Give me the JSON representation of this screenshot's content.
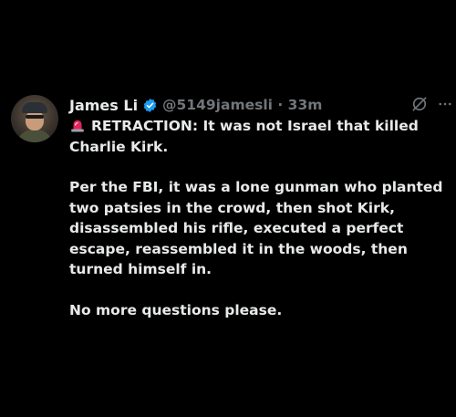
{
  "author": {
    "display_name": "James Li",
    "handle_time": "@5149jamesli · 33m"
  },
  "icons": {
    "avatar": "profile-photo",
    "verified": "verified-badge-icon",
    "grok": "grok-icon",
    "more": "more-options-icon",
    "siren": "police-siren-emoji"
  },
  "tweet": {
    "line1": "RETRACTION: It was not Israel that killed",
    "line2": "Charlie Kirk.",
    "para2": "Per the FBI, it was a lone gunman who planted two patsies in the crowd, then shot Kirk, disassembled his rifle, executed a perfect escape, reassembled it in the woods, then turned himself in.",
    "para3": "No more questions please."
  },
  "colors": {
    "background": "#000000",
    "text": "#e7e9ea",
    "muted": "#71767b",
    "verified": "#1d9bf0"
  }
}
